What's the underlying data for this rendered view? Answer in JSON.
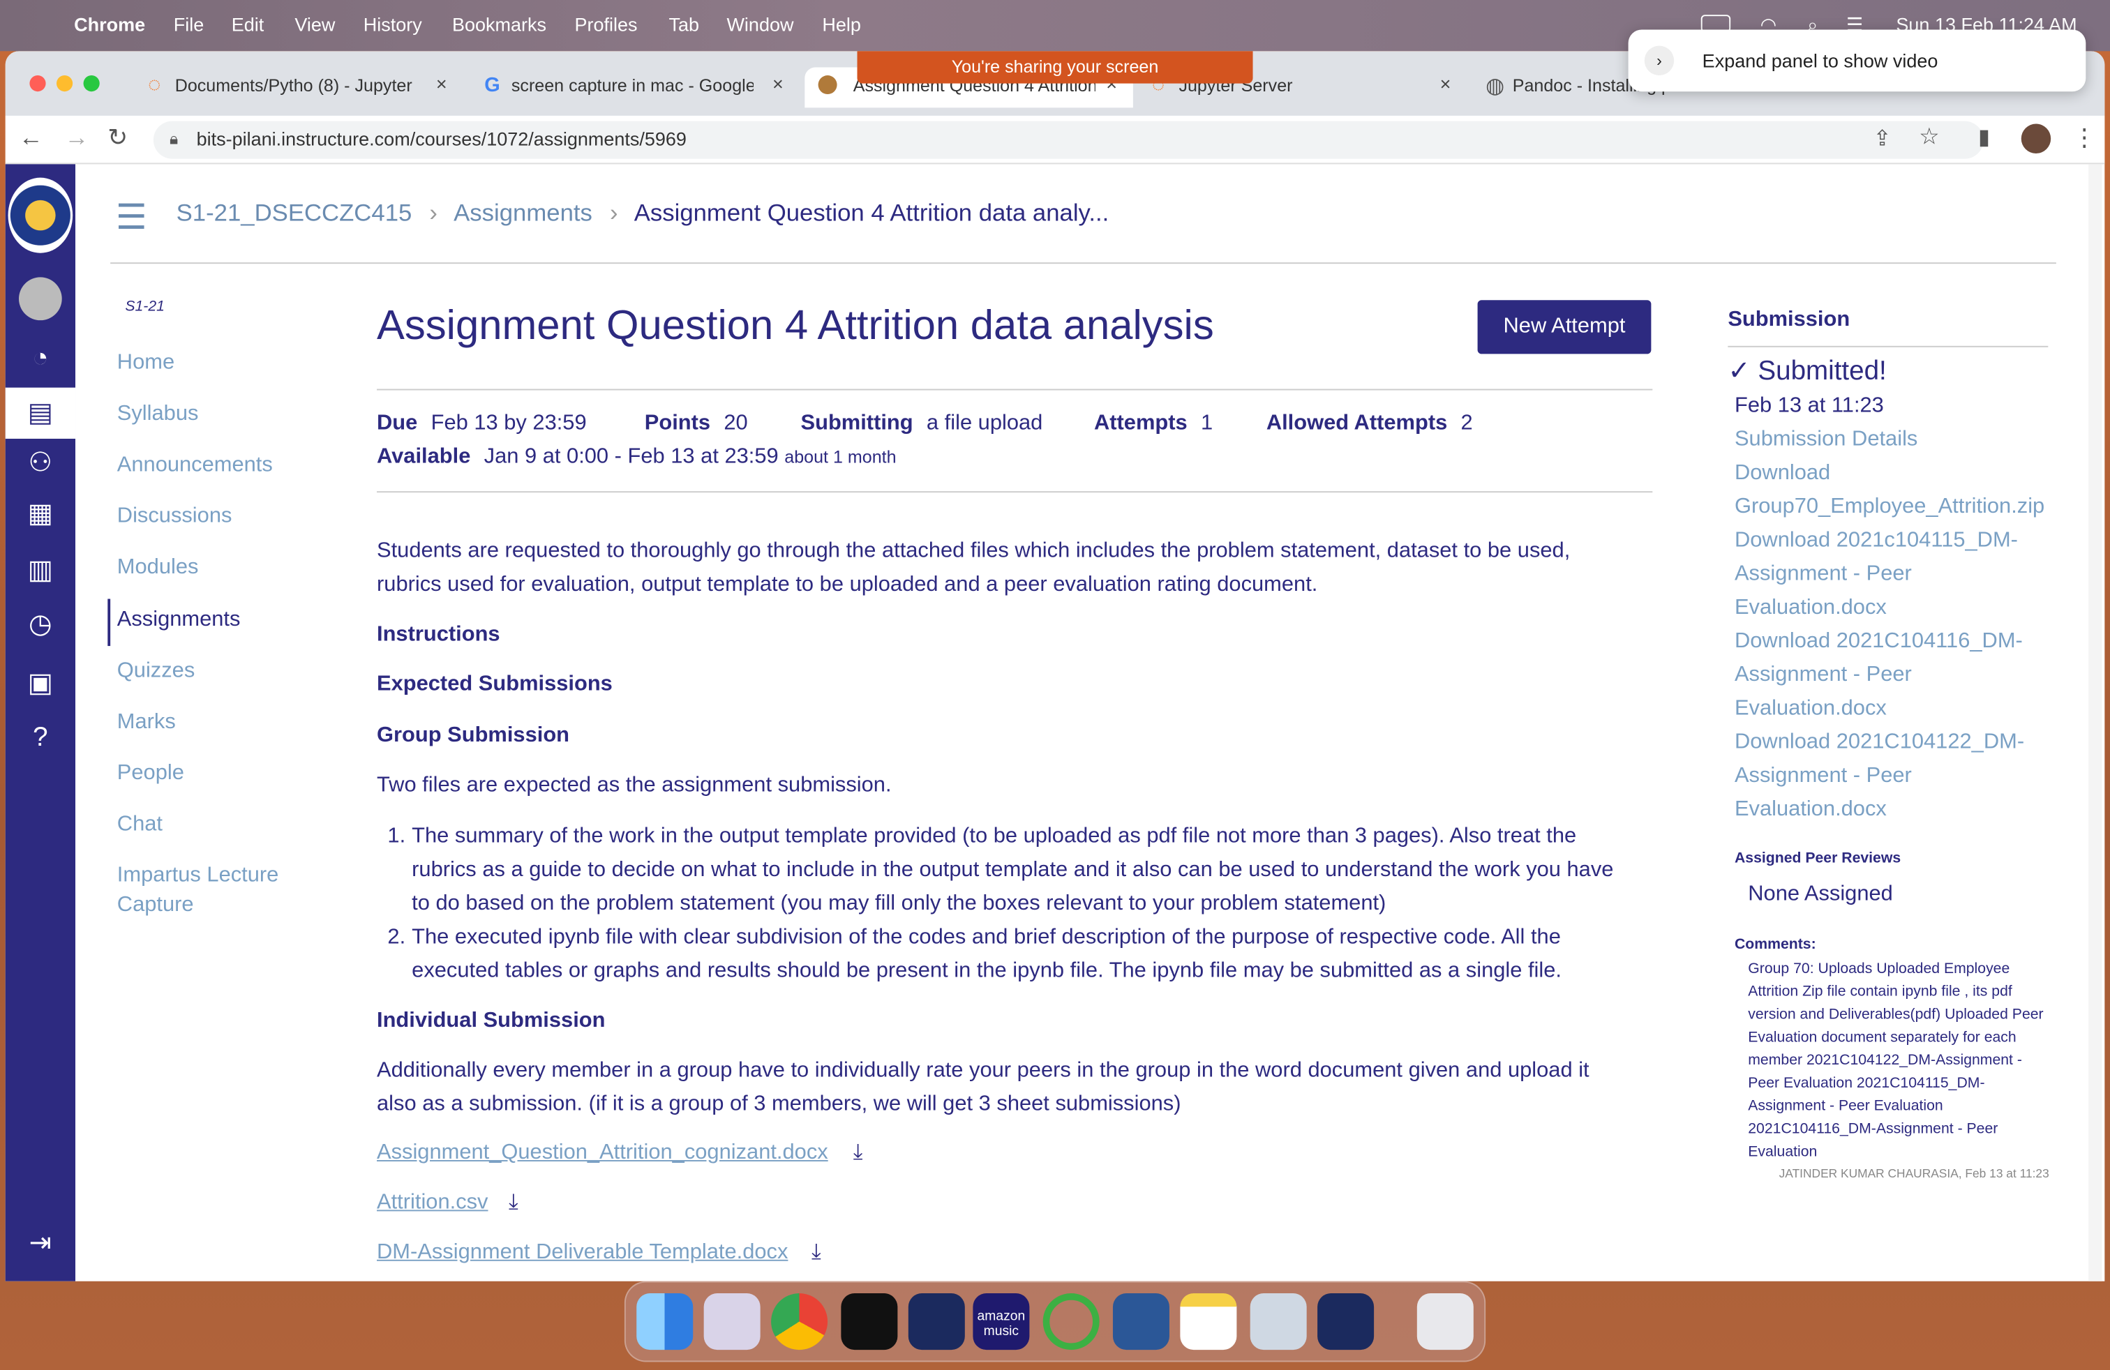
{
  "menubar": {
    "apple": "",
    "app": "Chrome",
    "items": [
      "File",
      "Edit",
      "View",
      "History",
      "Bookmarks",
      "Profiles",
      "Tab",
      "Window",
      "Help"
    ],
    "datetime": "Sun 13 Feb  11:24 AM"
  },
  "share_banner": "You're sharing your screen",
  "notification": "Expand panel to show video",
  "tabs": [
    {
      "title": "Documents/Pytho (8) - Jupyter",
      "close": "×"
    },
    {
      "title": "screen capture in mac - Google",
      "close": "×"
    },
    {
      "title": "Assignment Question 4 Attrition",
      "close": "×"
    },
    {
      "title": "Jupyter Server",
      "close": "×"
    },
    {
      "title": "Pandoc - Installing pandoc",
      "close": "×"
    }
  ],
  "url": "bits-pilani.instructure.com/courses/1072/assignments/5969",
  "breadcrumb": {
    "course": "S1-21_DSECCZC415",
    "section": "Assignments",
    "current": "Assignment Question 4 Attrition data analy..."
  },
  "course_nav": {
    "term": "S1-21",
    "items": [
      "Home",
      "Syllabus",
      "Announcements",
      "Discussions",
      "Modules",
      "Assignments",
      "Quizzes",
      "Marks",
      "People",
      "Chat",
      "Impartus Lecture",
      "Capture"
    ],
    "active": "Assignments"
  },
  "assignment": {
    "title": "Assignment Question 4 Attrition data analysis",
    "new_attempt": "New Attempt",
    "due_label": "Due",
    "due": "Feb 13 by 23:59",
    "points_label": "Points",
    "points": "20",
    "submitting_label": "Submitting",
    "submitting": "a file upload",
    "attempts_label": "Attempts",
    "attempts": "1",
    "allowed_label": "Allowed Attempts",
    "allowed": "2",
    "available_label": "Available",
    "available": "Jan 9 at 0:00 - Feb 13 at 23:59",
    "available_rel": "about 1 month",
    "intro1": "Students are requested to thoroughly go through the attached files which includes the problem statement, dataset to be used,",
    "intro2": "rubrics used for evaluation, output template to be uploaded and a peer evaluation rating document.",
    "h_instructions": "Instructions",
    "h_expected": "Expected Submissions",
    "h_group": "Group Submission",
    "two_files": "Two files are expected as the assignment submission.",
    "li1_a": "The summary of the work in the output template provided (to be uploaded as pdf file not more than 3 pages). Also treat the",
    "li1_b": "rubrics as a guide to decide on what to include in the output template and it also can be used to understand the work you have",
    "li1_c": "to do based on the problem statement (you may fill only the boxes relevant to your problem statement)",
    "li2_a": "The executed ipynb file with clear subdivision of the codes and brief description of the purpose of respective code. All the",
    "li2_b": "executed tables or graphs and results should be present in the ipynb file. The ipynb file may be submitted as a single file.",
    "h_individual": "Individual Submission",
    "ind_a": "Additionally every member in a group have to individually rate your peers in the group in the word document given and upload it",
    "ind_b": "also as a submission. (if it is a group of 3 members, we will get 3 sheet submissions)",
    "files": [
      "Assignment_Question_Attrition_cognizant.docx",
      "Attrition.csv",
      "DM-Assignment Deliverable Template.docx"
    ]
  },
  "submission": {
    "heading": "Submission",
    "status": "Submitted!",
    "date": "Feb 13 at 11:23",
    "details": "Submission Details",
    "download_lines": [
      "Download",
      "Group70_Employee_Attrition.zip",
      "Download 2021c104115_DM-",
      "Assignment - Peer",
      "Evaluation.docx",
      "Download 2021C104116_DM-",
      "Assignment - Peer",
      "Evaluation.docx",
      "Download 2021C104122_DM-",
      "Assignment - Peer",
      "Evaluation.docx"
    ],
    "peer_heading": "Assigned Peer Reviews",
    "peer_value": "None Assigned",
    "comments_heading": "Comments:",
    "comment_lines": [
      "Group 70: Uploads Uploaded Employee",
      "Attrition Zip file contain ipynb file , its pdf",
      "version and Deliverables(pdf) Uploaded Peer",
      "Evaluation document separately for each",
      "member 2021C104122_DM-Assignment -",
      "Peer Evaluation 2021C104115_DM-",
      "Assignment - Peer Evaluation",
      "2021C104116_DM-Assignment - Peer",
      "Evaluation"
    ],
    "comment_author": "JATINDER KUMAR CHAURASIA, Feb 13 at 11:23"
  },
  "dock_label": "amazon music"
}
